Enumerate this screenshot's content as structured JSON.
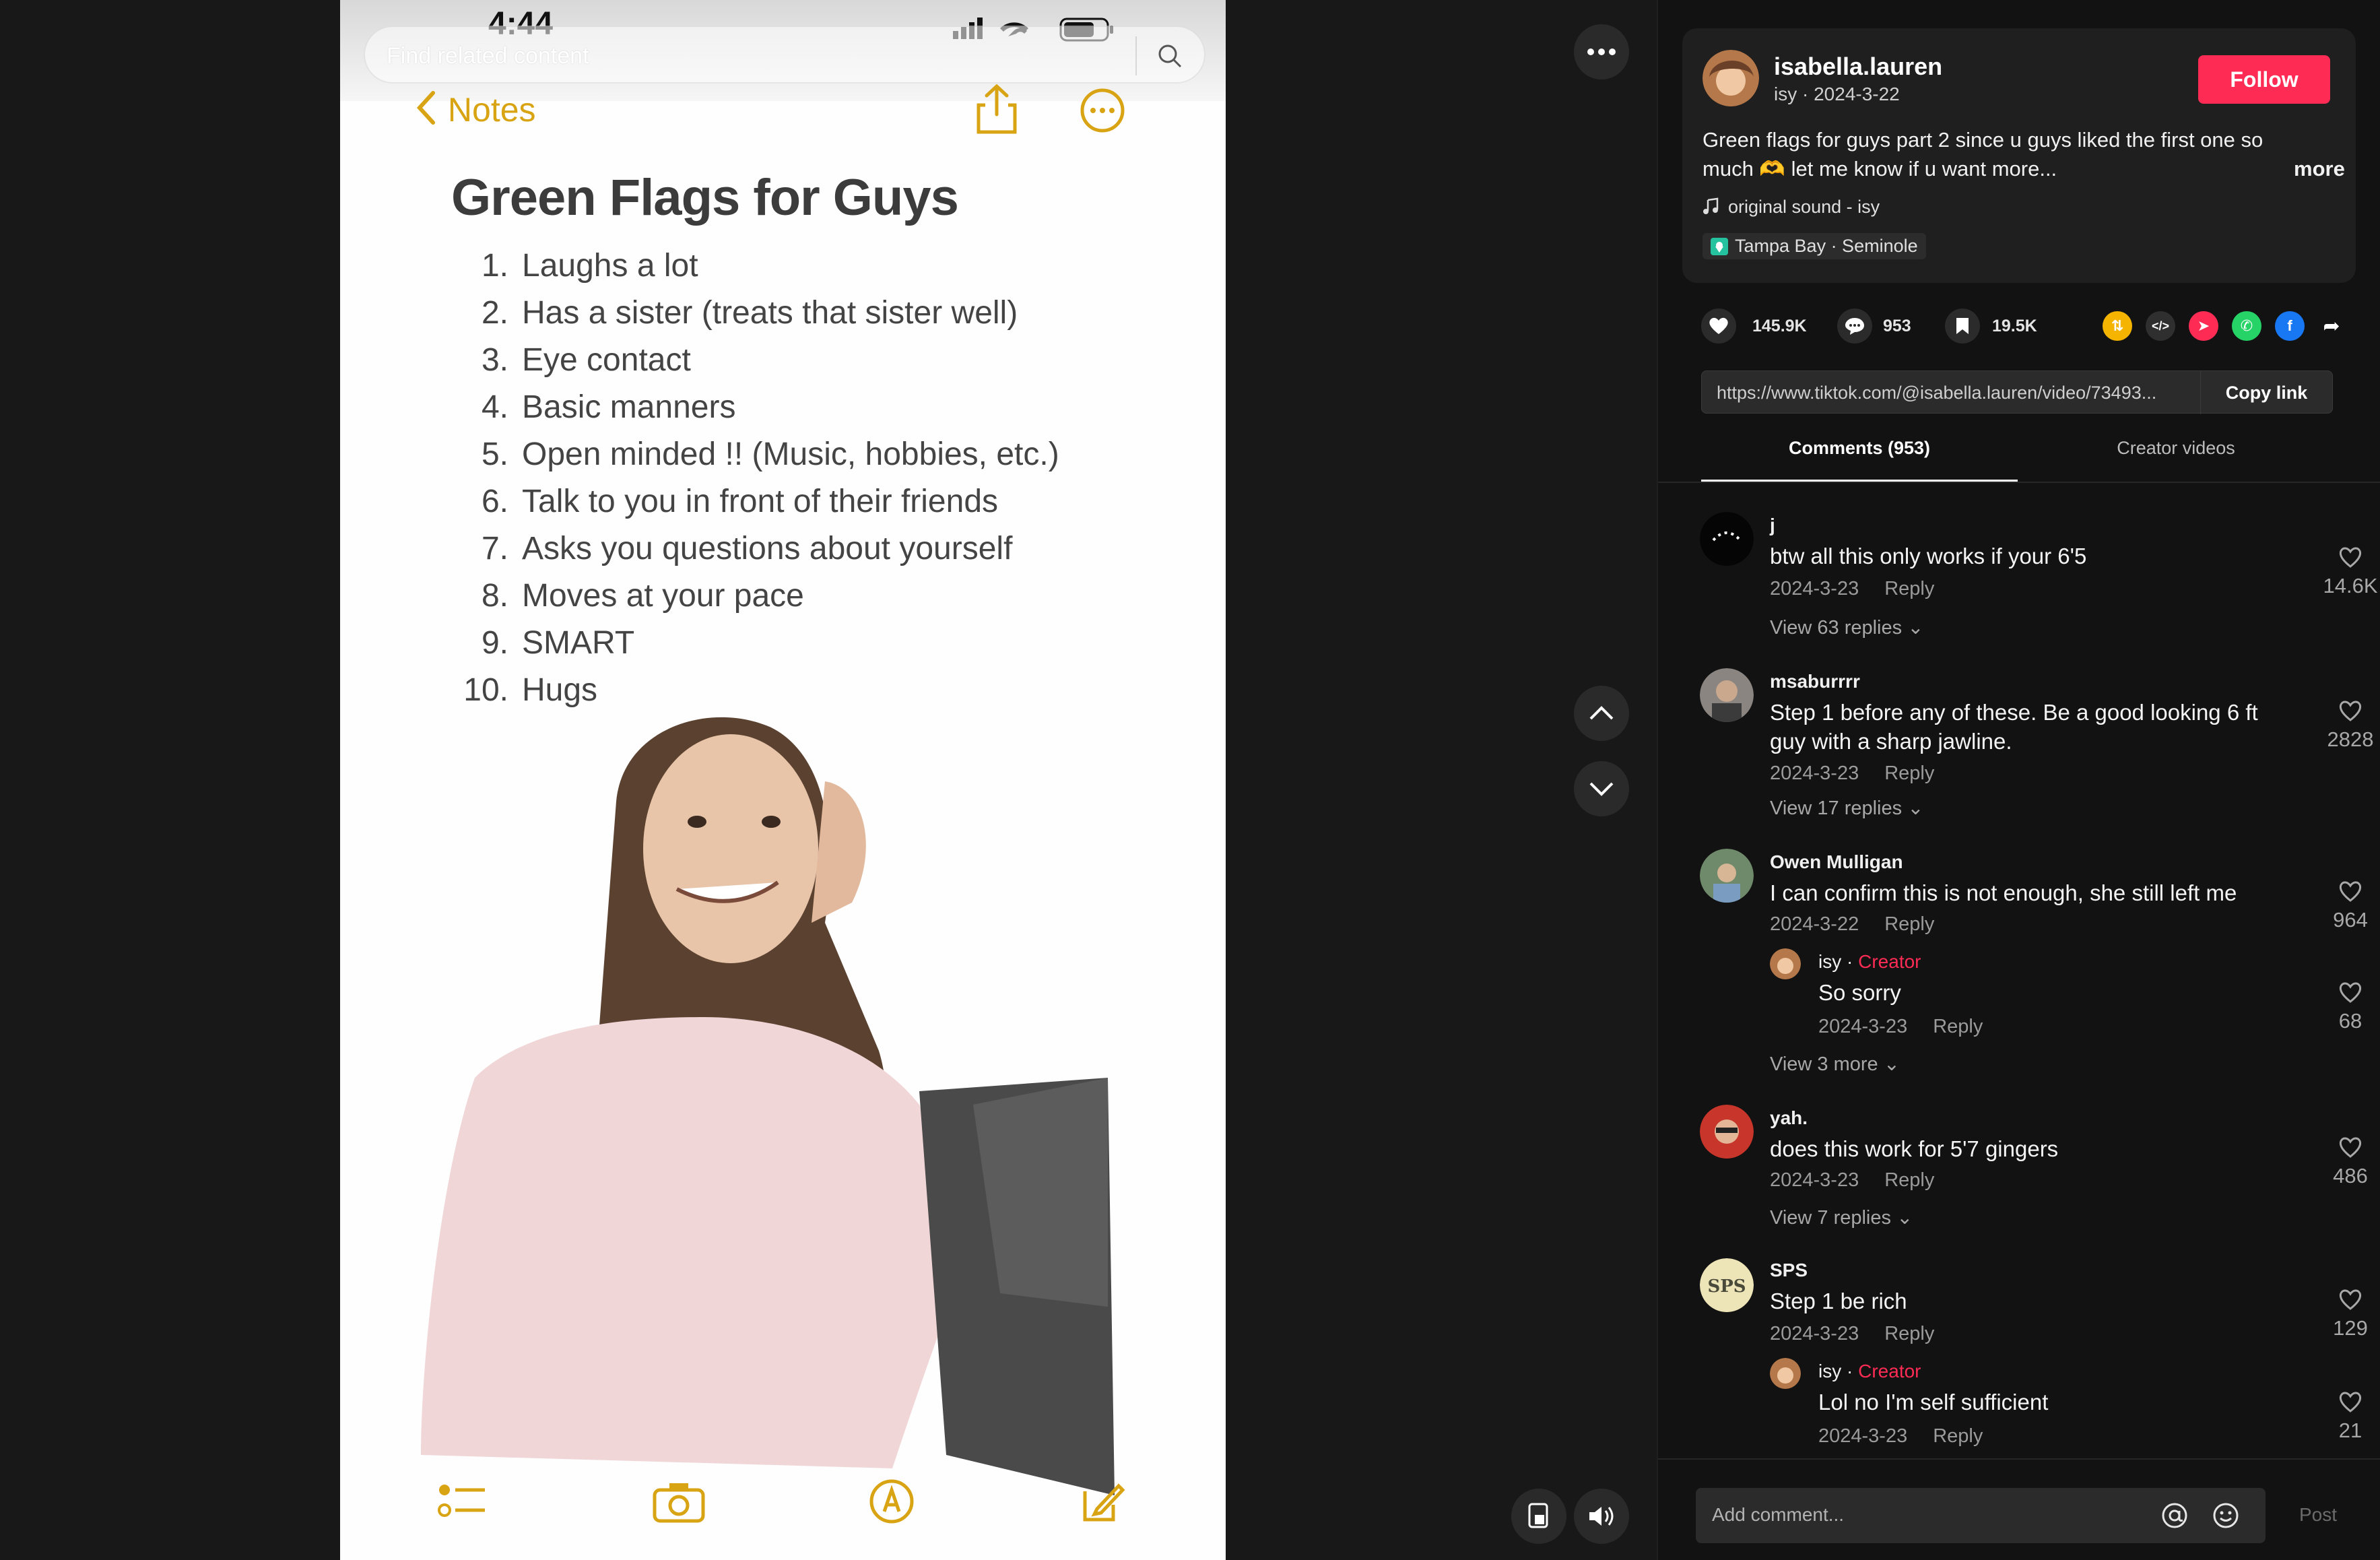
{
  "phone": {
    "time": "4:44",
    "search_placeholder": "Find related content",
    "back_label": "Notes"
  },
  "note": {
    "title": "Green Flags for Guys",
    "items": [
      "Laughs a lot",
      "Has a sister (treats that sister well)",
      "Eye contact",
      "Basic manners",
      "Open minded !! (Music, hobbies, etc.)",
      "Talk to you in front of their friends",
      "Asks you questions about yourself",
      "Moves at your pace",
      "SMART",
      "Hugs"
    ]
  },
  "author": {
    "username": "isabella.lauren",
    "display": "isy · 2024-3-22",
    "follow_label": "Follow"
  },
  "post": {
    "description": "Green flags for guys part 2 since u guys liked the first one so much 🫶 let me know if u want more...",
    "more_label": "more",
    "sound": "original sound - isy",
    "location": "Tampa Bay · Seminole"
  },
  "stats": {
    "likes": "145.9K",
    "comments": "953",
    "saves": "19.5K"
  },
  "link": {
    "url": "https://www.tiktok.com/@isabella.lauren/video/73493...",
    "copy_label": "Copy link"
  },
  "tabs": {
    "comments": "Comments (953)",
    "creator_videos": "Creator videos"
  },
  "comments": [
    {
      "name": "j",
      "text": "btw all this only works if your 6'5",
      "date": "2024-3-23",
      "reply": "Reply",
      "likes": "14.6K",
      "view": "View 63 replies"
    },
    {
      "name": "msaburrrr",
      "text": "Step 1 before any of these. Be a good looking 6 ft guy with a sharp jawline.",
      "date": "2024-3-23",
      "reply": "Reply",
      "likes": "2828",
      "view": "View 17 replies"
    },
    {
      "name": "Owen Mulligan",
      "text": "I can confirm this is not enough, she still left me",
      "date": "2024-3-22",
      "reply": "Reply",
      "likes": "964",
      "view": "View 3 more",
      "sub": {
        "name": "isy",
        "tag": "Creator",
        "text": "So sorry",
        "date": "2024-3-23",
        "reply": "Reply",
        "likes": "68"
      }
    },
    {
      "name": "yah.",
      "text": "does this work for 5'7 gingers",
      "date": "2024-3-23",
      "reply": "Reply",
      "likes": "486",
      "view": "View 7 replies"
    },
    {
      "name": "SPS",
      "text": "Step 1 be rich",
      "date": "2024-3-23",
      "reply": "Reply",
      "likes": "129",
      "sub": {
        "name": "isy",
        "tag": "Creator",
        "text": "Lol no I'm self sufficient",
        "date": "2024-3-23",
        "reply": "Reply",
        "likes": "21"
      }
    }
  ],
  "avatar_text": {
    "sps": "SPS"
  },
  "composer": {
    "placeholder": "Add comment...",
    "post_label": "Post"
  },
  "colors": {
    "accent": "#fe2c55",
    "notes_yellow": "#d9a413",
    "panel_bg": "#121212"
  }
}
